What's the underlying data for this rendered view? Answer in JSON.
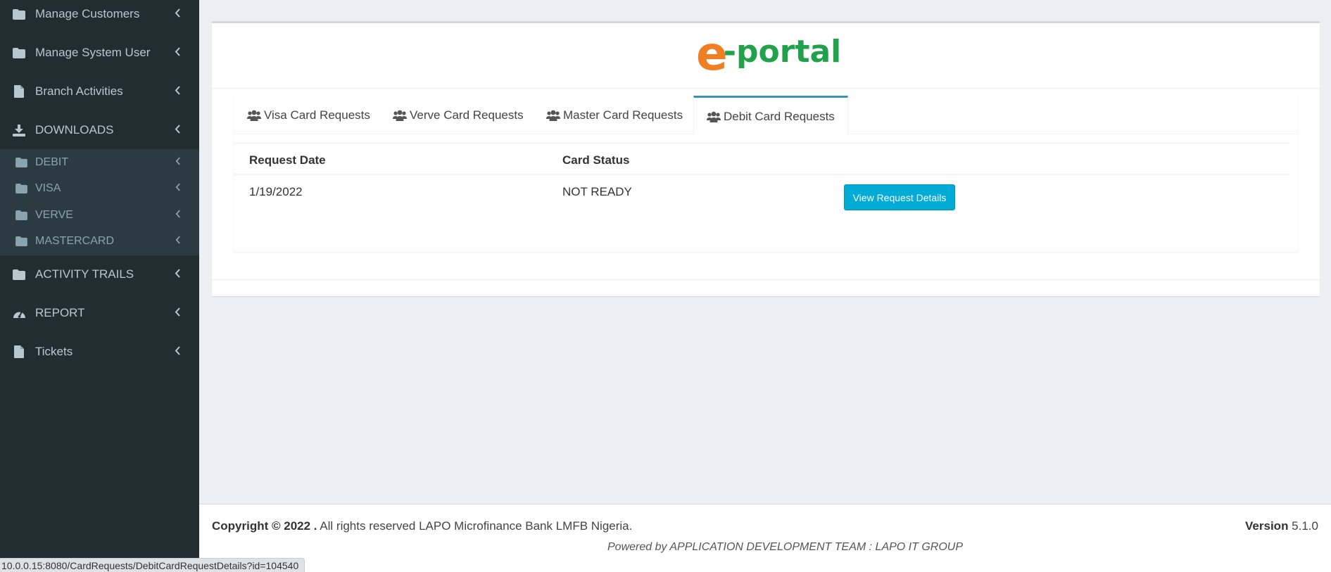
{
  "sidebar": {
    "items": [
      {
        "label": "Manage Customers",
        "icon": "folder-icon"
      },
      {
        "label": "Manage System User",
        "icon": "folder-icon"
      },
      {
        "label": "Branch Activities",
        "icon": "file-icon"
      },
      {
        "label": "DOWNLOADS",
        "icon": "download-icon"
      },
      {
        "label": "ACTIVITY TRAILS",
        "icon": "folder-icon"
      },
      {
        "label": "REPORT",
        "icon": "dashboard-icon"
      },
      {
        "label": "Tickets",
        "icon": "file-icon"
      }
    ],
    "downloads_sub": [
      {
        "label": "DEBIT"
      },
      {
        "label": "VISA"
      },
      {
        "label": "VERVE"
      },
      {
        "label": "MASTERCARD"
      }
    ]
  },
  "logo": {
    "e": "e",
    "text": "-portal",
    "e_color": "#f07f24",
    "text_color": "#22a14b"
  },
  "tabs": [
    {
      "label": "Visa Card Requests"
    },
    {
      "label": "Verve Card Requests"
    },
    {
      "label": "Master Card Requests"
    },
    {
      "label": "Debit Card Requests",
      "active": true
    }
  ],
  "table": {
    "headers": [
      "Request Date",
      "Card Status"
    ],
    "rows": [
      {
        "date": "1/19/2022",
        "status": "NOT READY",
        "action": "View Request Details"
      }
    ]
  },
  "footer": {
    "copyright_bold": "Copyright © 2022 .",
    "copyright_text": " All rights reserved LAPO Microfinance Bank LMFB Nigeria.",
    "version_label": "Version",
    "version_value": " 5.1.0",
    "powered": "Powered by APPLICATION DEVELOPMENT TEAM : LAPO IT GROUP"
  },
  "status_bar": {
    "url": "10.0.0.15:8080/CardRequests/DebitCardRequestDetails?id=104540"
  },
  "colors": {
    "sidebar_bg": "#222d32",
    "accent": "#3c8dbc",
    "button": "#00acd6"
  }
}
